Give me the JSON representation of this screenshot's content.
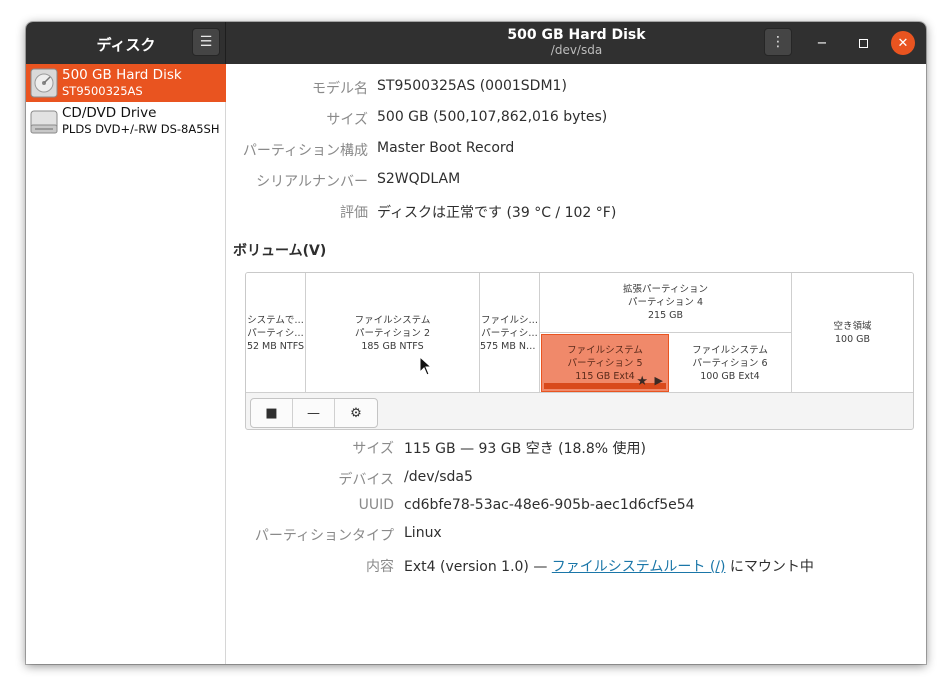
{
  "headerbar": {
    "app_title": "ディスク",
    "menu_icon": "hamburger-menu-icon",
    "title": "500 GB Hard Disk",
    "subtitle": "/dev/sda",
    "kebab_icon": "kebab-menu-icon",
    "close_color": "#e95420"
  },
  "sidebar": {
    "drives": [
      {
        "name": "500 GB Hard Disk",
        "model": "ST9500325AS",
        "icon": "hard-disk-icon",
        "selected": true
      },
      {
        "name": "CD/DVD Drive",
        "model": "PLDS DVD+/-RW DS-8A5SH",
        "icon": "optical-drive-icon",
        "selected": false
      }
    ]
  },
  "disk_info": {
    "model_label": "モデル名",
    "model_value": "ST9500325AS (0001SDM1)",
    "size_label": "サイズ",
    "size_value": "500 GB (500,107,862,016 bytes)",
    "partitioning_label": "パーティション構成",
    "partitioning_value": "Master Boot Record",
    "serial_label": "シリアルナンバー",
    "serial_value": "S2WQDLAM",
    "assessment_label": "評価",
    "assessment_value": "ディスクは正常です (39 °C / 102 °F)"
  },
  "volumes": {
    "title": "ボリューム(V)",
    "partitions": [
      {
        "line1": "システムで…",
        "line2": "パーティシ…",
        "line3": "52 MB NTFS"
      },
      {
        "line1": "ファイルシステム",
        "line2": "パーティション 2",
        "line3": "185 GB NTFS"
      },
      {
        "line1": "ファイルシ…",
        "line2": "パーティシ…",
        "line3": "575 MB NT…"
      },
      {
        "line1": "拡張パーティション",
        "line2": "パーティション 4",
        "line3": "215 GB"
      },
      {
        "line1": "空き領域",
        "line2": "100 GB"
      }
    ],
    "logical": [
      {
        "line1": "ファイルシステム",
        "line2": "パーティション 5",
        "line3": "115 GB Ext4",
        "selected": true,
        "usage_fraction": 0.188
      },
      {
        "line1": "ファイルシステム",
        "line2": "パーティション 6",
        "line3": "100 GB Ext4",
        "selected": false
      }
    ],
    "toolbar": [
      {
        "icon": "stop-icon",
        "glyph": "■"
      },
      {
        "icon": "minus-icon",
        "glyph": "—"
      },
      {
        "icon": "gears-icon",
        "glyph": "⚙"
      }
    ]
  },
  "partition_info": {
    "size_label": "サイズ",
    "size_value": "115 GB — 93 GB 空き (18.8% 使用)",
    "device_label": "デバイス",
    "device_value": "/dev/sda5",
    "uuid_label": "UUID",
    "uuid_value": "cd6bfe78-53ac-48e6-905b-aec1d6cf5e54",
    "type_label": "パーティションタイプ",
    "type_value": "Linux",
    "contents_label": "内容",
    "contents_prefix": "Ext4 (version 1.0) — ",
    "contents_link": "ファイルシステムルート (/)",
    "contents_suffix": " にマウント中"
  }
}
